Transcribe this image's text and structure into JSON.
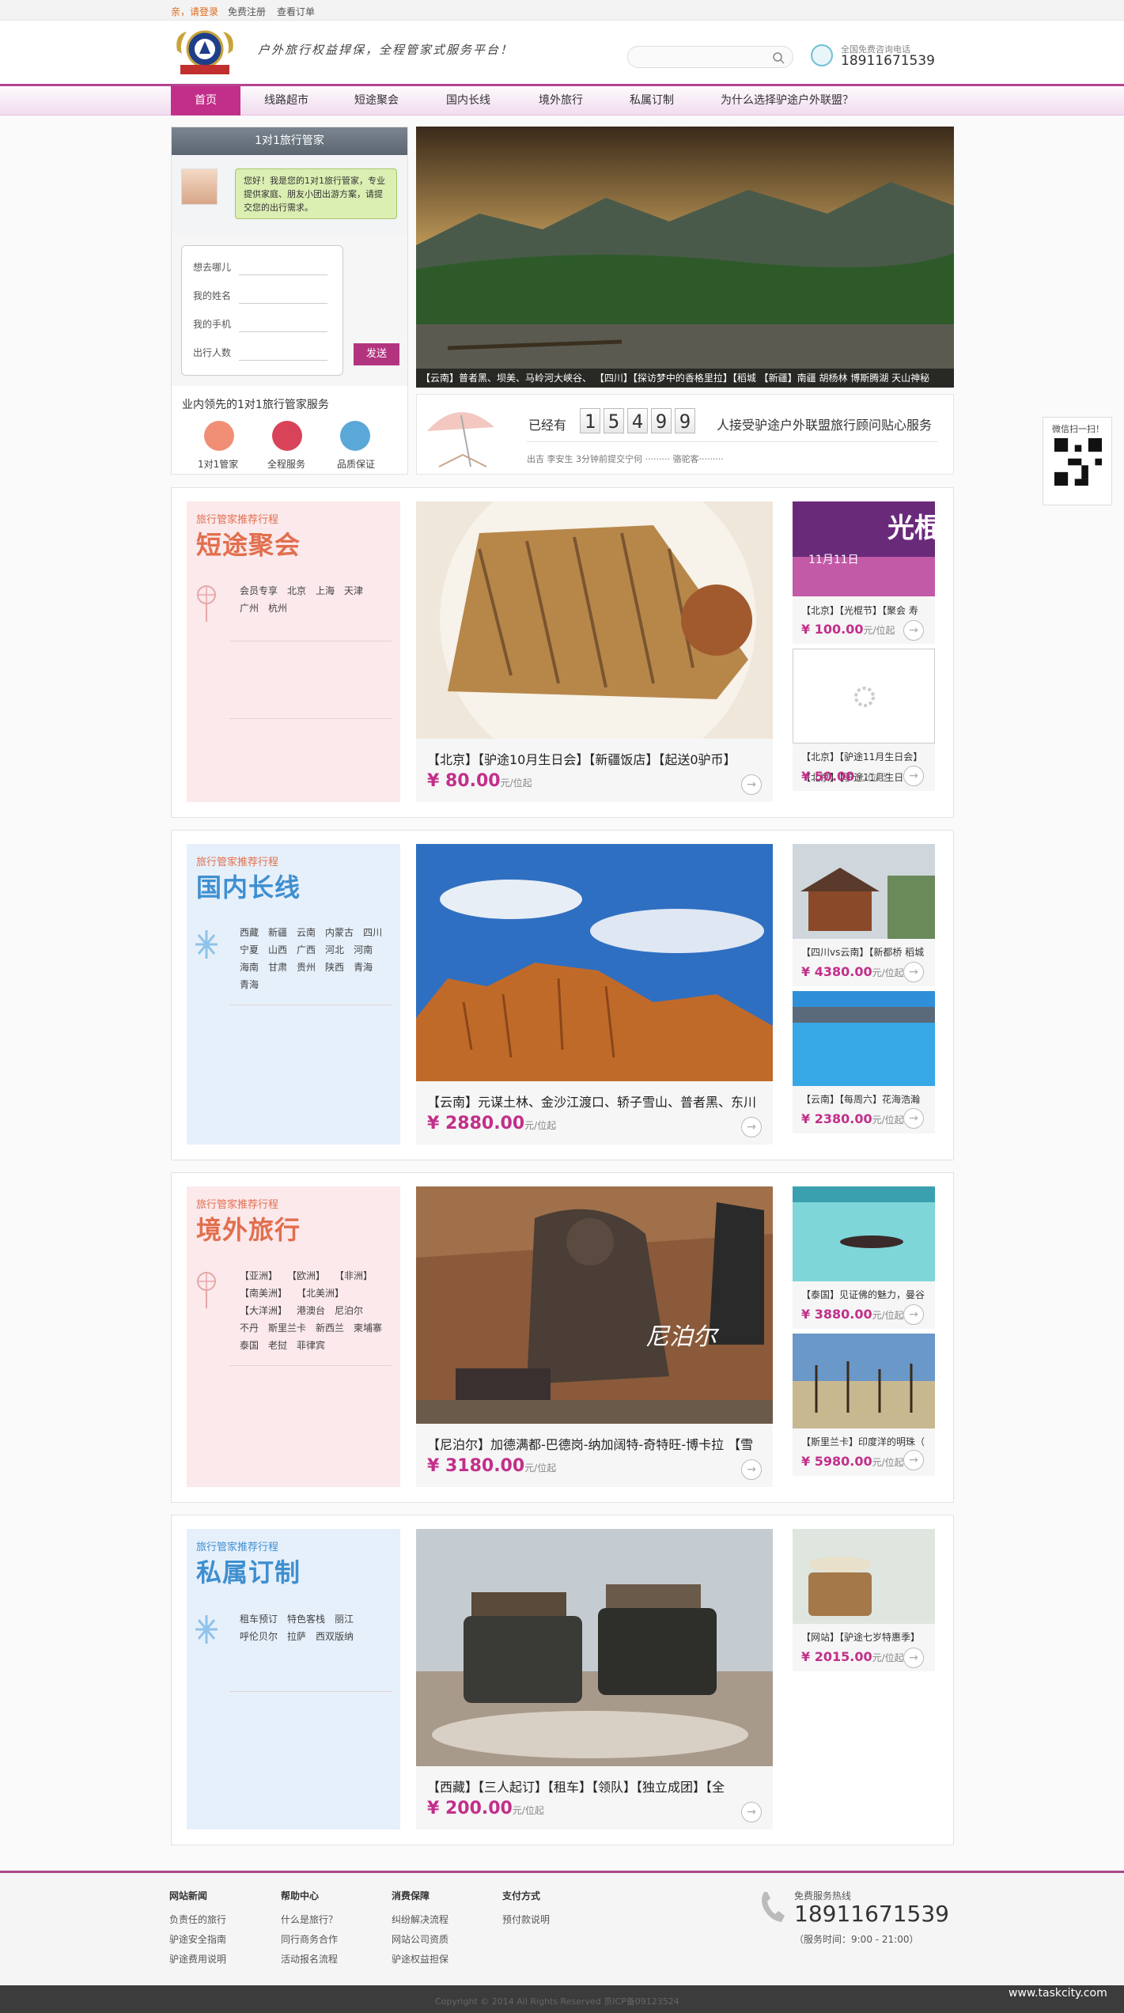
{
  "topbar": {
    "login": "亲，请登录",
    "register": "免费注册",
    "orders": "查看订单"
  },
  "header": {
    "slogan": "户外旅行权益捍保，全程管家式服务平台！",
    "search_placeholder": "",
    "hotline_label": "全国免费咨询电话",
    "hotline_number": "18911671539"
  },
  "nav": {
    "items": [
      {
        "label": "首页"
      },
      {
        "label": "线路超市"
      },
      {
        "label": "短途聚会"
      },
      {
        "label": "国内长线"
      },
      {
        "label": "境外旅行"
      },
      {
        "label": "私属订制"
      },
      {
        "label": "为什么选择驴途户外联盟？"
      }
    ]
  },
  "butler": {
    "title": "1对1旅行管家",
    "greeting": "您好！我是您的1对1旅行管家，专业提供家庭、朋友小团出游方案，请提交您的出行需求。",
    "fields": [
      "想去哪儿",
      "我的姓名",
      "我的手机",
      "出行人数"
    ],
    "send": "发送",
    "service_title": "业内领先的1对1旅行管家服务",
    "badges": [
      "1对1管家",
      "全程服务",
      "品质保证"
    ]
  },
  "banner": {
    "caption": "【云南】普者黑、坝美、马岭河大峡谷、    【四川】【探访梦中的香格里拉】【稻城     【新疆】南疆 胡杨林 博斯腾湖 天山神秘"
  },
  "counter": {
    "prefix": "已经有",
    "digits": [
      "1",
      "5",
      "4",
      "9",
      "9"
    ],
    "suffix": "人接受驴途户外联盟旅行顾问贴心服务",
    "ticker": "出吉   李安生   3分钟前提交宁何      ·········   骆驼客·········"
  },
  "qr": {
    "label": "微信扫一扫！"
  },
  "sections": [
    {
      "sub": "旅行管家推荐行程",
      "title": "短途聚会",
      "tags": [
        "会员专享",
        "北京",
        "上海",
        "天津",
        "广州",
        "杭州"
      ],
      "main_title": "【北京】【驴途10月生日会】【新疆饭店】【起送0驴币】",
      "main_price": "¥ 80.00",
      "unit": "元/位起",
      "thumbs": [
        {
          "title": "【北京】【光棍节】【聚会 寿",
          "price": "¥ 100.00"
        },
        {
          "title": "【北京】【驴途11月生日会】",
          "price": "¥ 50.00"
        }
      ],
      "thumb_text": "11月11日"
    },
    {
      "sub": "旅行管家推荐行程",
      "title": "国内长线",
      "tags": [
        "西藏",
        "新疆",
        "云南",
        "内蒙古",
        "四川",
        "宁夏",
        "山西",
        "广西",
        "河北",
        "河南",
        "海南",
        "甘肃",
        "贵州",
        "陕西",
        "青海",
        "青海"
      ],
      "main_title": "【云南】元谋土林、金沙江渡口、轿子雪山、普者黑、东川",
      "main_price": "¥ 2880.00",
      "unit": "元/位起",
      "thumbs": [
        {
          "title": "【四川vs云南】【新都桥 稻城",
          "price": "¥ 4380.00"
        },
        {
          "title": "【云南】【每周六】花海浩瀚",
          "price": "¥ 2380.00"
        }
      ]
    },
    {
      "sub": "旅行管家推荐行程",
      "title": "境外旅行",
      "tags": [
        "【亚洲】",
        "【欧洲】",
        "【非洲】",
        "【南美洲】",
        "【北美洲】",
        "【大洋洲】",
        "港澳台",
        "尼泊尔",
        "不丹",
        "斯里兰卡",
        "新西兰",
        "柬埔寨",
        "泰国",
        "老挝",
        "菲律宾"
      ],
      "main_title": "【尼泊尔】加德满都-巴德岗-纳加阔特-奇特旺-博卡拉 【雪",
      "main_price": "¥ 3180.00",
      "unit": "元/位起",
      "main_overlay": "尼泊尔",
      "thumbs": [
        {
          "title": "【泰国】见证佛的魅力，曼谷",
          "price": "¥ 3880.00"
        },
        {
          "title": "【斯里兰卡】印度洋的明珠（",
          "price": "¥ 5980.00"
        }
      ]
    },
    {
      "sub": "旅行管家推荐行程",
      "title": "私属订制",
      "tags": [
        "租车预订",
        "特色客栈",
        "丽江",
        "呼伦贝尔",
        "拉萨",
        "西双版纳"
      ],
      "main_title": "【西藏】【三人起订】【租车】【领队】【独立成团】【全",
      "main_price": "¥ 200.00",
      "unit": "元/位起",
      "thumbs": [
        {
          "title": "【网站】【驴途七岁特惠季】",
          "price": "¥ 2015.00"
        }
      ]
    }
  ],
  "footer": {
    "cols": [
      {
        "head": "网站新闻",
        "items": [
          "负责任的旅行",
          "驴途安全指南",
          "驴途费用说明"
        ]
      },
      {
        "head": "帮助中心",
        "items": [
          "什么是旅行？",
          "同行商务合作",
          "活动报名流程"
        ]
      },
      {
        "head": "消费保障",
        "items": [
          "纠纷解决流程",
          "网站公司资质",
          "驴途权益担保"
        ]
      },
      {
        "head": "支付方式",
        "items": [
          "预付款说明"
        ]
      }
    ],
    "hotline_label": "免费服务热线",
    "hotline_number": "18911671539",
    "hours": "（服务时间：9:00 - 21:00）",
    "copyright": "Copyright © 2014 All Rights Reserved 京ICP备09123524",
    "watermark": "www.taskcity.com"
  },
  "colors": {
    "accent": "#c22f8a",
    "nav_border": "#b4448f",
    "side_pink": "#fbe9ec",
    "side_blue": "#e6f0fb"
  }
}
